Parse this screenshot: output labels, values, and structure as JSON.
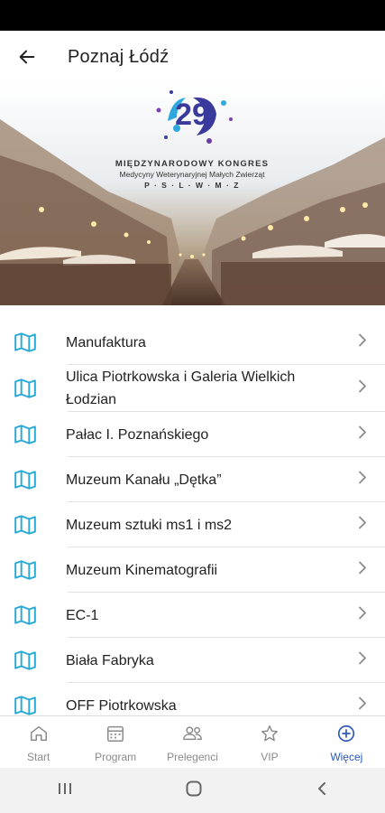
{
  "app_bar": {
    "title": "Poznaj Łódź",
    "back_icon": "arrow-left-icon"
  },
  "hero": {
    "logo_number": "29",
    "line1": "MIĘDZYNARODOWY KONGRES",
    "line2": "Medycyny Weterynaryjnej Małych Zwierząt",
    "line3": "P · S · L · W · M · Z"
  },
  "list": {
    "items": [
      {
        "label": "Manufaktura",
        "icon": "map-icon"
      },
      {
        "label": "Ulica Piotrkowska i Galeria Wielkich Łodzian",
        "icon": "map-icon"
      },
      {
        "label": "Pałac I. Poznańskiego",
        "icon": "map-icon"
      },
      {
        "label": "Muzeum Kanału „Dętka”",
        "icon": "map-icon"
      },
      {
        "label": "Muzeum sztuki ms1 i ms2",
        "icon": "map-icon"
      },
      {
        "label": "Muzeum Kinematografii",
        "icon": "map-icon"
      },
      {
        "label": "EC-1",
        "icon": "map-icon"
      },
      {
        "label": "Biała Fabryka",
        "icon": "map-icon"
      },
      {
        "label": "OFF Piotrkowska",
        "icon": "map-icon"
      }
    ]
  },
  "bottom_nav": {
    "items": [
      {
        "label": "Start",
        "icon": "home-icon"
      },
      {
        "label": "Program",
        "icon": "calendar-icon"
      },
      {
        "label": "Prelegenci",
        "icon": "people-icon"
      },
      {
        "label": "VIP",
        "icon": "star-icon"
      },
      {
        "label": "Więcej",
        "icon": "plus-circle-icon",
        "active": true
      }
    ]
  },
  "colors": {
    "accent": "#2a58b8",
    "map_icon": "#29a9d6",
    "inactive": "#8a8a8a"
  }
}
